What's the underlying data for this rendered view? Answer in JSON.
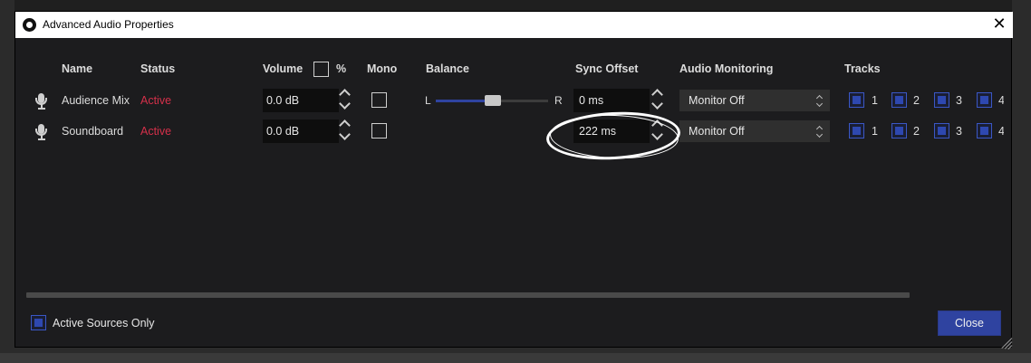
{
  "window": {
    "title": "Advanced Audio Properties",
    "close_glyph": "✕"
  },
  "headers": {
    "name": "Name",
    "status": "Status",
    "volume": "Volume",
    "percent": "%",
    "mono": "Mono",
    "balance": "Balance",
    "sync_offset": "Sync Offset",
    "audio_monitoring": "Audio Monitoring",
    "tracks": "Tracks"
  },
  "rows": [
    {
      "name": "Audience Mix",
      "status": "Active",
      "volume": "0.0 dB",
      "mono": false,
      "balance": {
        "left_label": "L",
        "right_label": "R",
        "value": 0.5
      },
      "sync_offset": "0 ms",
      "monitoring": "Monitor Off",
      "tracks": [
        {
          "label": "1",
          "checked": true
        },
        {
          "label": "2",
          "checked": true
        },
        {
          "label": "3",
          "checked": true
        },
        {
          "label": "4",
          "checked": true
        }
      ]
    },
    {
      "name": "Soundboard",
      "status": "Active",
      "volume": "0.0 dB",
      "mono": false,
      "sync_offset": "222 ms",
      "monitoring": "Monitor Off",
      "tracks": [
        {
          "label": "1",
          "checked": true
        },
        {
          "label": "2",
          "checked": true
        },
        {
          "label": "3",
          "checked": true
        },
        {
          "label": "4",
          "checked": true
        }
      ]
    }
  ],
  "footer": {
    "active_sources_only": "Active Sources Only",
    "active_sources_checked": true,
    "close_label": "Close"
  },
  "colors": {
    "status_active": "#d4304a",
    "accent": "#2f43a0",
    "background": "#1c1c1e",
    "titlebar": "#ffffff"
  },
  "icons": [
    "app-logo-icon",
    "close-icon",
    "microphone-icon",
    "spin-up-icon",
    "spin-down-icon",
    "chevron-updown-icon",
    "resize-grip-icon"
  ]
}
